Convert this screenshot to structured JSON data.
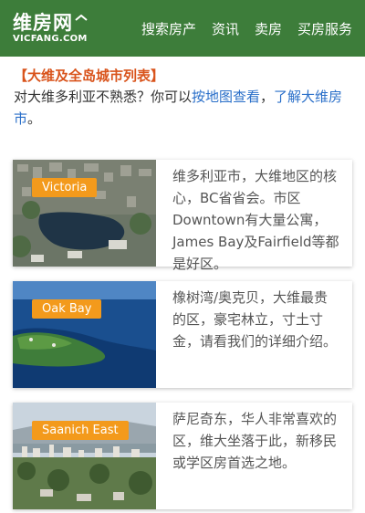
{
  "header": {
    "logo_cn": "维房网",
    "logo_en": "VICFANG.COM",
    "nav": [
      "搜索房产",
      "资讯",
      "卖房",
      "买房服务"
    ]
  },
  "intro": {
    "title": "【大维及全岛城市列表】",
    "text_before": "对大维多利亚不熟悉？你可以",
    "link1": "按地图查看",
    "sep": "，",
    "link2": "了解大维房市",
    "text_after": "。"
  },
  "cards": [
    {
      "tag": "Victoria",
      "desc": "维多利亚市，大维地区的核心，BC省省会。市区Downtown有大量公寓，James Bay及Fairfield等都是好区。"
    },
    {
      "tag": "Oak Bay",
      "desc": "橡树湾/奥克贝，大维最贵的区，豪宅林立，寸土寸金，请看我们的详细介绍。"
    },
    {
      "tag": "Saanich East",
      "desc": "萨尼奇东，华人非常喜欢的区，维大坐落于此，新移民或学区房首选之地。"
    }
  ],
  "colors": {
    "header_bg": "#3d7d3a",
    "tag_bg": "#f39a1c",
    "title": "#d9541c",
    "link": "#2a6fc9"
  }
}
